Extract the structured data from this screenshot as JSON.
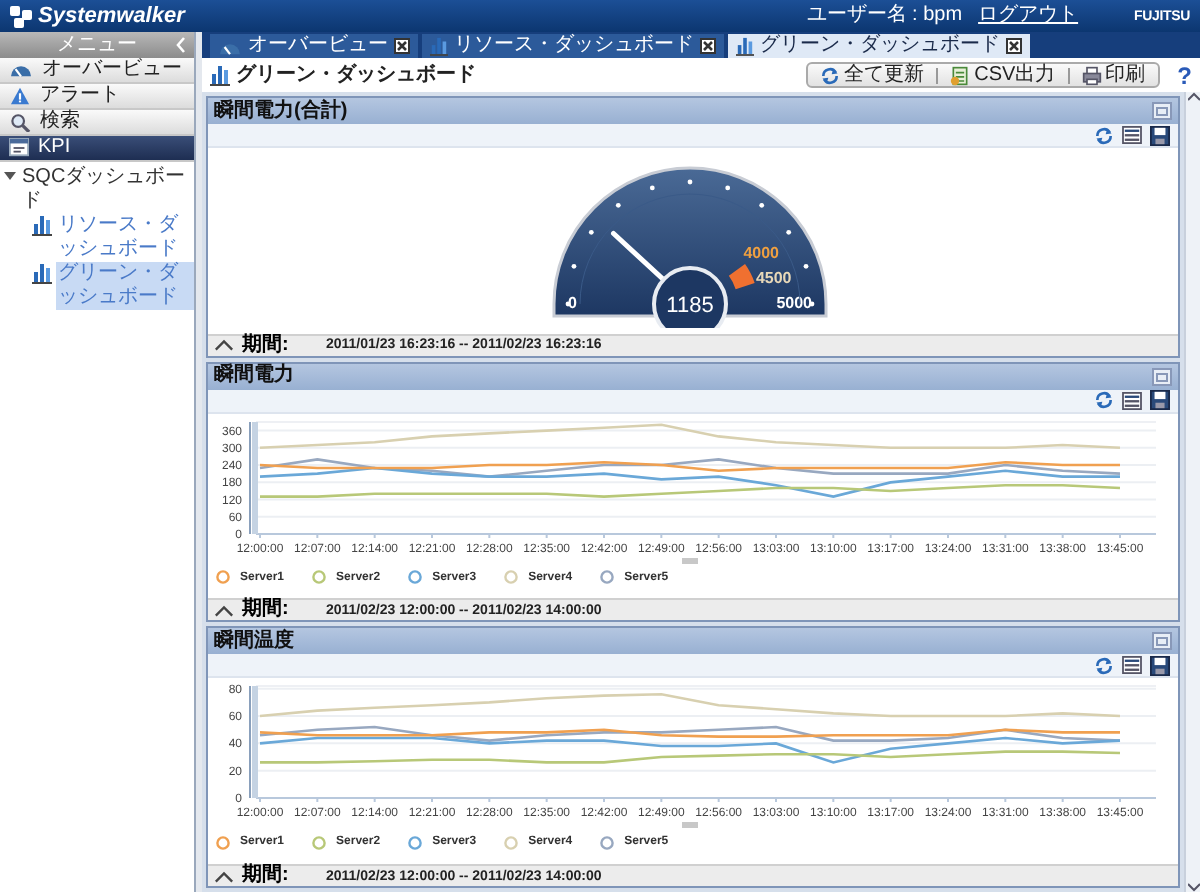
{
  "header": {
    "logo": "Systemwalker",
    "user": "ユーザー名 : bpm",
    "logout": "ログアウト",
    "brand": "FUJITSU"
  },
  "sidebar": {
    "title": "メニュー",
    "items": [
      {
        "label": "オーバービュー",
        "selected": false
      },
      {
        "label": "アラート",
        "selected": false
      },
      {
        "label": "検索",
        "selected": false
      },
      {
        "label": "KPI",
        "selected": true
      }
    ],
    "tree": [
      {
        "label": "SQCダッシュボード",
        "expanded": true,
        "selected": false,
        "children": [
          {
            "label": "リソース・ダッシュボード",
            "selected": false
          },
          {
            "label": "グリーン・ダッシュボード",
            "selected": true
          }
        ]
      }
    ]
  },
  "tabs": [
    {
      "label": "オーバービュー",
      "selected": false
    },
    {
      "label": "リソース・ダッシュボード",
      "selected": false
    },
    {
      "label": "グリーン・ダッシュボード",
      "selected": true
    }
  ],
  "page": {
    "title": "グリーン・ダッシュボード",
    "buttons": [
      "全て更新",
      "CSV出力",
      "印刷"
    ],
    "help": "?"
  },
  "panels": [
    {
      "kind": "gauge",
      "title": "瞬間電力(合計)",
      "gauge": {
        "level": 0.237,
        "reading": "1185",
        "min_label": "0",
        "max_label": "5000",
        "marks": [
          "4000",
          "4500"
        ]
      },
      "period_label": "期間:",
      "period": "2011/01/23 16:23:16 -- 2011/02/23 16:23:16"
    },
    {
      "kind": "line",
      "title": "瞬間電力",
      "chart_data": {
        "type": "line",
        "categories": [
          "12:00:00",
          "12:07:00",
          "12:14:00",
          "12:21:00",
          "12:28:00",
          "12:35:00",
          "12:42:00",
          "12:49:00",
          "12:56:00",
          "13:03:00",
          "13:10:00",
          "13:17:00",
          "13:24:00",
          "13:31:00",
          "13:38:00",
          "13:45:00"
        ],
        "ylim": [
          0,
          390
        ],
        "yticks": [
          0,
          60,
          120,
          180,
          240,
          300,
          360
        ],
        "series": [
          {
            "name": "Server1",
            "color": "#f0a050",
            "values": [
              240,
              230,
              230,
              230,
              240,
              240,
              250,
              240,
              220,
              230,
              230,
              230,
              230,
              250,
              240,
              240
            ]
          },
          {
            "name": "Server2",
            "color": "#b8c878",
            "values": [
              130,
              130,
              140,
              140,
              140,
              140,
              130,
              140,
              150,
              160,
              160,
              150,
              160,
              170,
              170,
              160
            ]
          },
          {
            "name": "Server3",
            "color": "#6aa8d8",
            "values": [
              200,
              210,
              230,
              210,
              200,
              200,
              210,
              190,
              200,
              170,
              130,
              180,
              200,
              220,
              200,
              200
            ]
          },
          {
            "name": "Server4",
            "color": "#d8d0b0",
            "values": [
              300,
              310,
              320,
              340,
              350,
              360,
              370,
              380,
              340,
              320,
              310,
              300,
              300,
              300,
              310,
              300
            ]
          },
          {
            "name": "Server5",
            "color": "#98a8c0",
            "values": [
              230,
              260,
              230,
              220,
              200,
              220,
              240,
              240,
              260,
              230,
              210,
              210,
              210,
              240,
              220,
              210
            ]
          }
        ],
        "grid": true,
        "legend": "bottom"
      },
      "period_label": "期間:",
      "period": "2011/02/23 12:00:00 -- 2011/02/23 14:00:00"
    },
    {
      "kind": "line",
      "title": "瞬間温度",
      "chart_data": {
        "type": "line",
        "categories": [
          "12:00:00",
          "12:07:00",
          "12:14:00",
          "12:21:00",
          "12:28:00",
          "12:35:00",
          "12:42:00",
          "12:49:00",
          "12:56:00",
          "13:03:00",
          "13:10:00",
          "13:17:00",
          "13:24:00",
          "13:31:00",
          "13:38:00",
          "13:45:00"
        ],
        "ylim": [
          0,
          82
        ],
        "yticks": [
          0,
          20,
          40,
          60,
          80
        ],
        "series": [
          {
            "name": "Server1",
            "color": "#f0a050",
            "values": [
              48,
              46,
              46,
              46,
              48,
              48,
              50,
              46,
              45,
              45,
              46,
              46,
              46,
              50,
              48,
              48
            ]
          },
          {
            "name": "Server2",
            "color": "#b8c878",
            "values": [
              26,
              26,
              27,
              28,
              28,
              26,
              26,
              30,
              31,
              32,
              32,
              30,
              32,
              34,
              34,
              33
            ]
          },
          {
            "name": "Server3",
            "color": "#6aa8d8",
            "values": [
              40,
              44,
              44,
              44,
              40,
              42,
              42,
              38,
              38,
              40,
              26,
              36,
              40,
              44,
              40,
              42
            ]
          },
          {
            "name": "Server4",
            "color": "#d8d0b0",
            "values": [
              60,
              64,
              66,
              68,
              70,
              73,
              75,
              76,
              68,
              65,
              62,
              60,
              60,
              60,
              62,
              60
            ]
          },
          {
            "name": "Server5",
            "color": "#98a8c0",
            "values": [
              46,
              50,
              52,
              46,
              42,
              46,
              48,
              48,
              50,
              52,
              42,
              42,
              44,
              50,
              44,
              42
            ]
          }
        ],
        "grid": true,
        "legend": "bottom"
      },
      "period_label": "期間:",
      "period": "2011/02/23 12:00:00 -- 2011/02/23 14:00:00"
    }
  ]
}
